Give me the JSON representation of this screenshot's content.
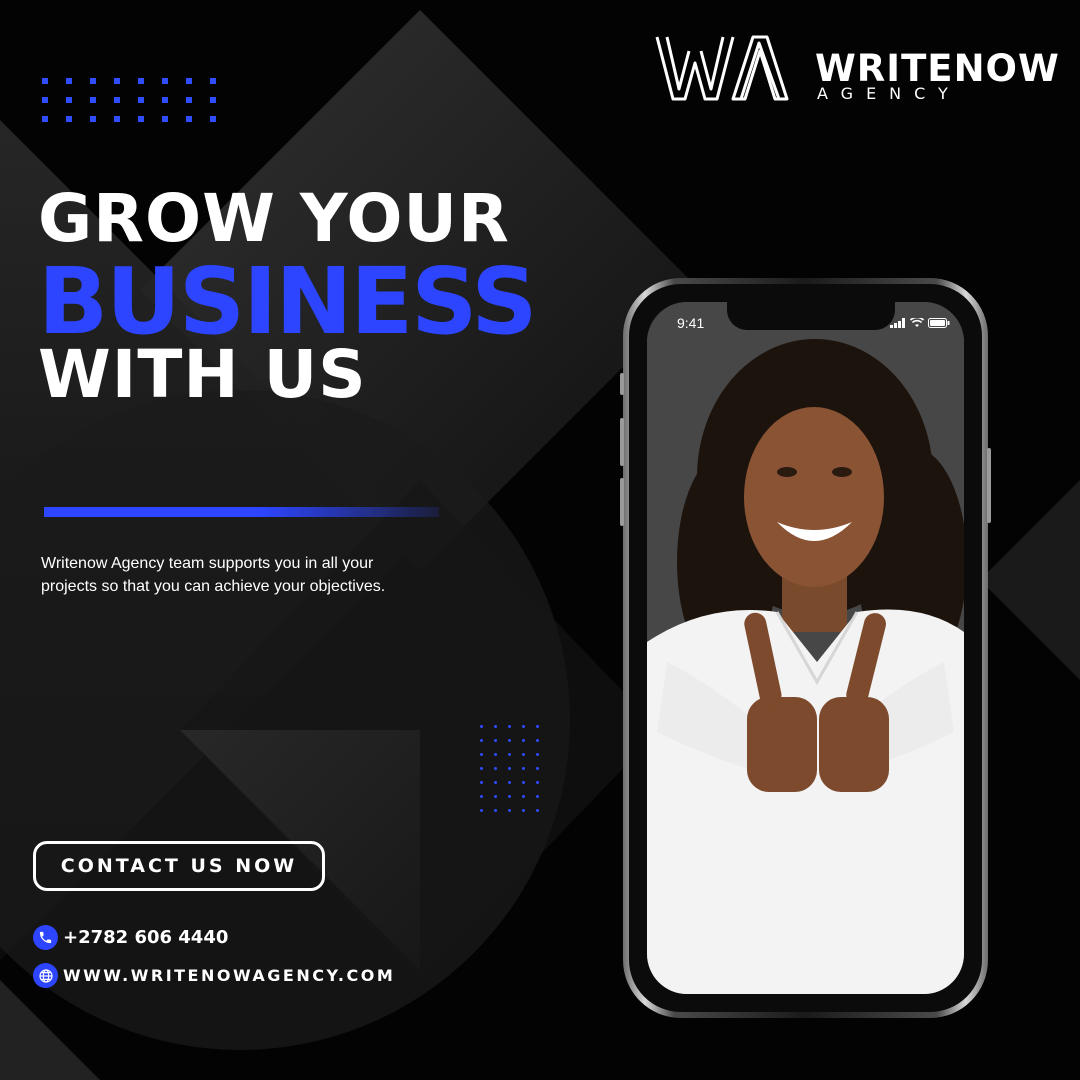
{
  "brand": {
    "name": "WRITENOW",
    "subtitle": "AGENCY"
  },
  "headline": {
    "line1": "GROW YOUR",
    "line2": "BUSINESS",
    "line3": "WITH US"
  },
  "description": "Writenow Agency team supports you in all your projects so that you can achieve your objectives.",
  "cta_label": "CONTACT US NOW",
  "contact": {
    "phone": "+2782 606 4440",
    "website": "WWW.WRITENOWAGENCY.COM"
  },
  "phone_mockup": {
    "time": "9:41"
  },
  "colors": {
    "accent": "#2d45ff",
    "background": "#030303",
    "text": "#ffffff"
  },
  "icons": [
    "phone-icon",
    "globe-icon",
    "signal-icon",
    "wifi-icon",
    "battery-icon"
  ]
}
